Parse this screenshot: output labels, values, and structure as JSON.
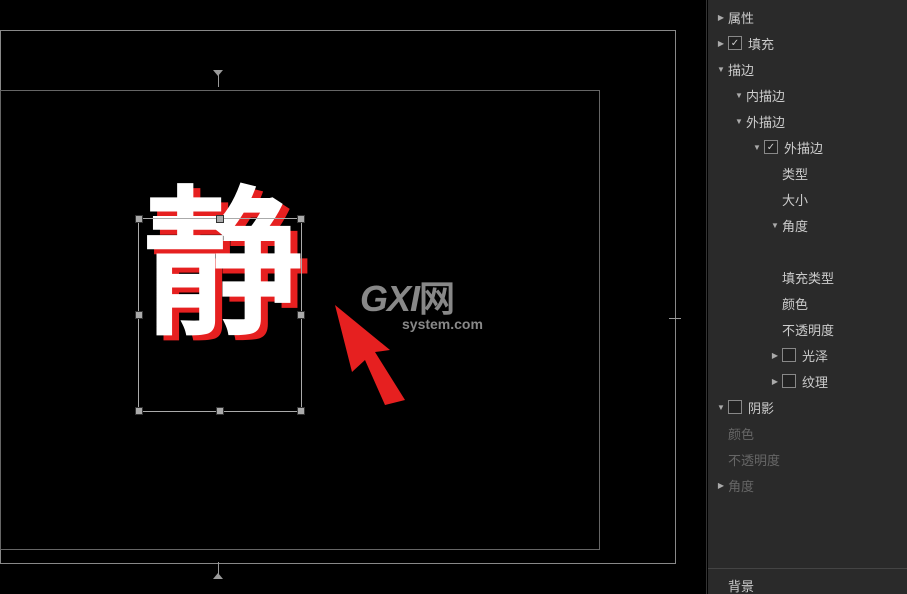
{
  "canvas": {
    "text_content": "静",
    "watermark_main": "GXI",
    "watermark_suffix": "网",
    "watermark_sub": "system.com"
  },
  "panel": {
    "attributes": "属性",
    "fill": "填充",
    "stroke": "描边",
    "inner_stroke": "内描边",
    "outer_stroke": "外描边",
    "outer_stroke_item": "外描边",
    "type": "类型",
    "size": "大小",
    "angle": "角度",
    "fill_type": "填充类型",
    "color": "颜色",
    "opacity": "不透明度",
    "gloss": "光泽",
    "texture": "纹理",
    "shadow": "阴影",
    "shadow_color": "颜色",
    "shadow_opacity": "不透明度",
    "shadow_angle": "角度",
    "background": "背景"
  }
}
